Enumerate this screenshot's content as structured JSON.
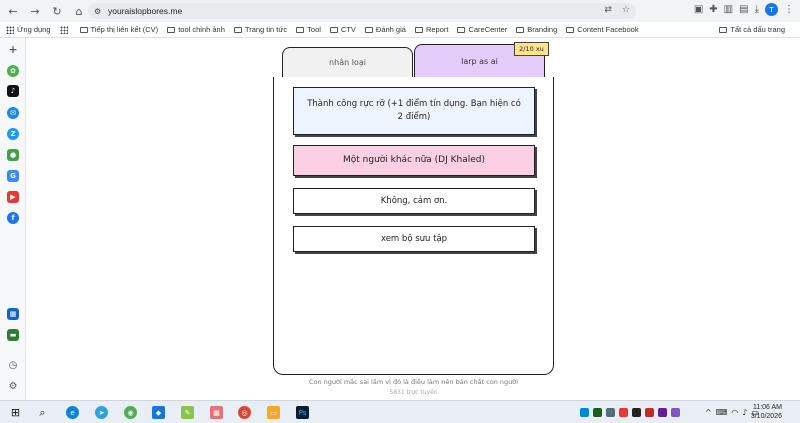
{
  "browser": {
    "url": "youraislopbores.me",
    "bookmarks": [
      {
        "label": "Ứng dụng",
        "type": "apps"
      },
      {
        "label": "Tiếp thị liên kết (CV)",
        "type": "folder"
      },
      {
        "label": "tool chỉnh ảnh",
        "type": "folder"
      },
      {
        "label": "Trang tin tức",
        "type": "folder"
      },
      {
        "label": "Tool",
        "type": "folder"
      },
      {
        "label": "CTV",
        "type": "folder"
      },
      {
        "label": "Đánh giá",
        "type": "folder"
      },
      {
        "label": "Report",
        "type": "folder"
      },
      {
        "label": "CareCenter",
        "type": "folder"
      },
      {
        "label": "Branding",
        "type": "folder"
      },
      {
        "label": "Content Facebook",
        "type": "folder"
      }
    ],
    "all_bookmarks_label": "Tất cả dấu trang",
    "profile_initial": "T"
  },
  "tabs": {
    "human": "nhân loại",
    "larp": "larp as ai"
  },
  "badge": "2/10 xu",
  "cards": {
    "success": "Thành công rực rỡ (+1 điểm tín dụng. Bạn hiện có 2 điểm)",
    "another": "Một người khác nữa (DJ Khaled)",
    "no_thanks": "Không, cảm ơn.",
    "collection": "xem bộ sưu tập"
  },
  "footer": {
    "line1": "Con người mắc sai lầm vì đó là điều làm nên bản chất con người",
    "line2": "5831 trực tuyến"
  },
  "clock": {
    "time": "11:06 AM",
    "date": "3/10/2026"
  },
  "colors": {
    "tab_active": "#e5cdfb",
    "badge": "#fde68a",
    "card_success": "#eef4fd",
    "card_another": "#fbcfe4"
  }
}
